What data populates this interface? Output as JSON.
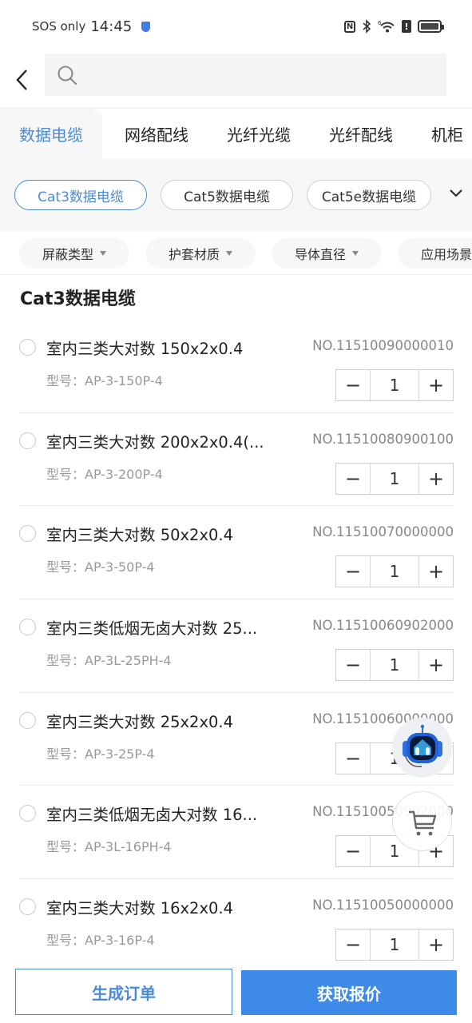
{
  "status_bar": {
    "carrier": "SOS only",
    "time": "14:45",
    "nfc_label": "N",
    "signal_label": "6",
    "alert_label": "!"
  },
  "search": {
    "placeholder": "",
    "value": ""
  },
  "category_tabs": [
    {
      "label": "数据电缆",
      "active": true
    },
    {
      "label": "网络配线",
      "active": false
    },
    {
      "label": "光纤光缆",
      "active": false
    },
    {
      "label": "光纤配线",
      "active": false
    },
    {
      "label": "机柜",
      "active": false
    }
  ],
  "sub_categories": [
    {
      "label": "Cat3数据电缆",
      "active": true
    },
    {
      "label": "Cat5数据电缆",
      "active": false
    },
    {
      "label": "Cat5e数据电缆",
      "active": false
    }
  ],
  "filters": [
    {
      "label": "屏蔽类型"
    },
    {
      "label": "护套材质"
    },
    {
      "label": "导体直径"
    },
    {
      "label": "应用场景"
    }
  ],
  "section_title": "Cat3数据电缆",
  "products": [
    {
      "name": "室内三类大对数 150x2x0.4",
      "no": "NO.11510090000010",
      "model": "型号：AP-3-150P-4",
      "qty": "1"
    },
    {
      "name": "室内三类大对数 200x2x0.4(...",
      "no": "NO.11510080900100",
      "model": "型号：AP-3-200P-4",
      "qty": "1"
    },
    {
      "name": "室内三类大对数 50x2x0.4",
      "no": "NO.11510070000000",
      "model": "型号：AP-3-50P-4",
      "qty": "1"
    },
    {
      "name": "室内三类低烟无卤大对数 25...",
      "no": "NO.11510060902000",
      "model": "型号：AP-3L-25PH-4",
      "qty": "1"
    },
    {
      "name": "室内三类大对数 25x2x0.4",
      "no": "NO.11510060000000",
      "model": "型号：AP-3-25P-4",
      "qty": "1"
    },
    {
      "name": "室内三类低烟无卤大对数 16...",
      "no": "NO.11510050902000",
      "model": "型号：AP-3L-16PH-4",
      "qty": "1"
    },
    {
      "name": "室内三类大对数 16x2x0.4",
      "no": "NO.11510050000000",
      "model": "型号：AP-3-16P-4",
      "qty": "1"
    }
  ],
  "stepper": {
    "minus": "−",
    "plus": "+"
  },
  "actions": {
    "generate_order": "生成订单",
    "get_quote": "获取报价"
  },
  "colors": {
    "accent": "#4a8ad6",
    "primary_button": "#3d8ae8"
  }
}
